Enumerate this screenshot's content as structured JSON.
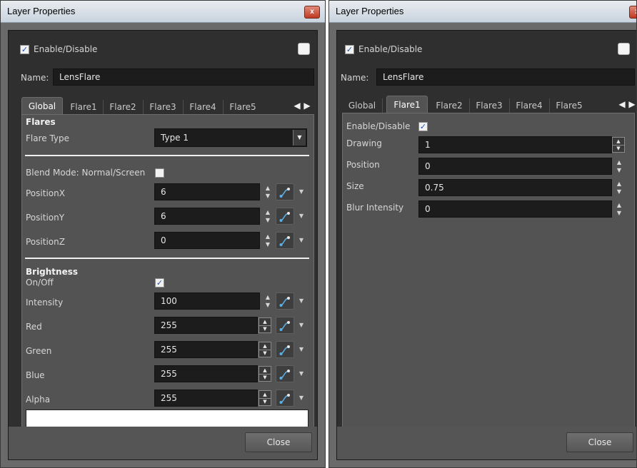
{
  "left_window": {
    "title": "Layer Properties",
    "close_glyph": "x",
    "enable_label": "Enable/Disable",
    "enable_checked": true,
    "name_label": "Name:",
    "name_value": "LensFlare",
    "tabs": [
      "Global",
      "Flare1",
      "Flare2",
      "Flare3",
      "Flare4",
      "Flare5"
    ],
    "active_tab": "Global",
    "tab_prev_glyph": "◀",
    "tab_next_glyph": "▶",
    "flares_section": {
      "title": "Flares",
      "flare_type_label": "Flare Type",
      "flare_type_value": "Type 1"
    },
    "blend_mode_label": "Blend Mode: Normal/Screen",
    "blend_mode_checked": false,
    "position_rows": [
      {
        "label": "PositionX",
        "value": "6"
      },
      {
        "label": "PositionY",
        "value": "6"
      },
      {
        "label": "PositionZ",
        "value": "0"
      }
    ],
    "brightness_section": {
      "title": "Brightness",
      "onoff_label": "On/Off",
      "onoff_checked": true,
      "rows": [
        {
          "label": "Intensity",
          "value": "100"
        },
        {
          "label": "Red",
          "value": "255"
        },
        {
          "label": "Green",
          "value": "255"
        },
        {
          "label": "Blue",
          "value": "255"
        },
        {
          "label": "Alpha",
          "value": "255"
        }
      ]
    },
    "swatch_color": "#ffffff",
    "close_button": "Close"
  },
  "right_window": {
    "title": "Layer Properties",
    "close_glyph": "x",
    "enable_label": "Enable/Disable",
    "enable_checked": true,
    "name_label": "Name:",
    "name_value": "LensFlare",
    "tabs": [
      "Global",
      "Flare1",
      "Flare2",
      "Flare3",
      "Flare4",
      "Flare5"
    ],
    "active_tab": "Flare1",
    "tab_prev_glyph": "◀",
    "tab_next_glyph": "▶",
    "flare_enable_label": "Enable/Disable",
    "flare_enable_checked": true,
    "rows": [
      {
        "label": "Drawing",
        "value": "1"
      },
      {
        "label": "Position",
        "value": "0"
      },
      {
        "label": "Size",
        "value": "0.75"
      },
      {
        "label": "Blur Intensity",
        "value": "0"
      }
    ],
    "close_button": "Close"
  },
  "icons": {
    "function_curve": "function-curve-icon",
    "spinner": "spinner-icon",
    "dropdown": "chevron-down-icon",
    "checkmark": "checkmark-icon"
  },
  "colors": {
    "window_bg": "#6a6a6a",
    "panel_bg": "#535353",
    "field_bg": "#1c1c1c",
    "checkmark": "#1f4fa8",
    "function_accent": "#5ab0e6"
  }
}
